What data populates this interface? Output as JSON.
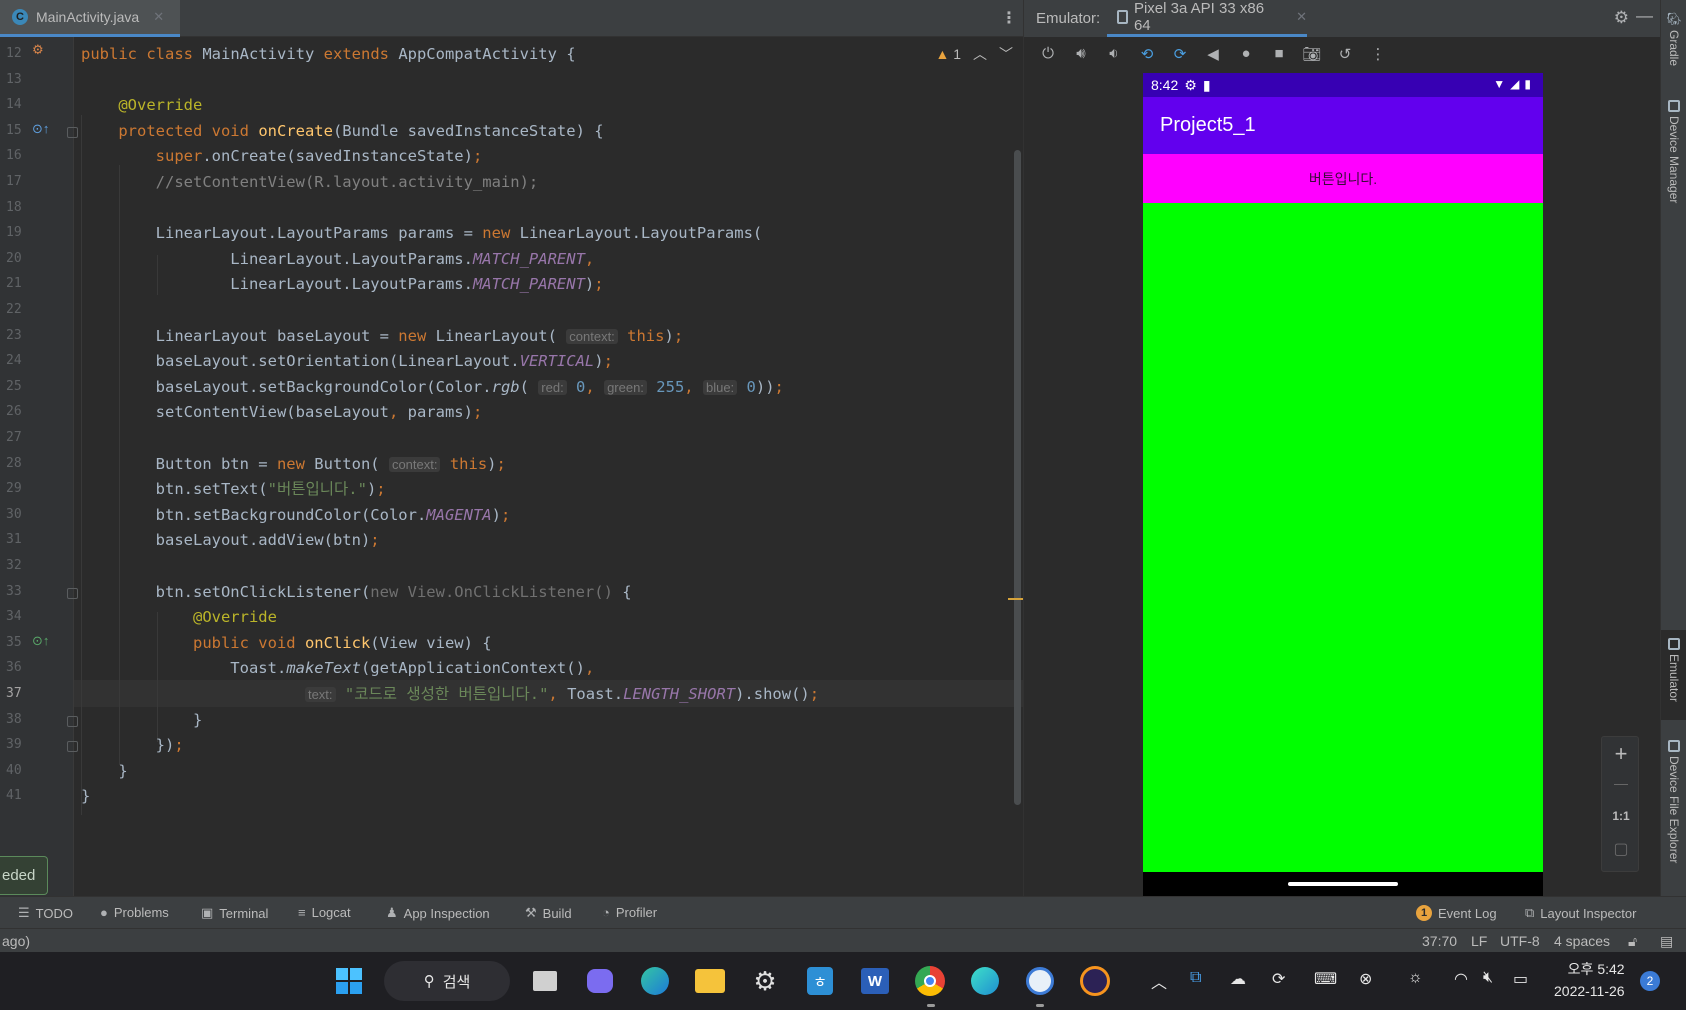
{
  "editor": {
    "tab_label": "MainActivity.java",
    "tab_badge": "C",
    "warning_count": "1",
    "lines": [
      {
        "n": "12",
        "html": "<span class='kw'>public class </span>MainActivity <span class='kw'>extends </span>AppCompatActivity {"
      },
      {
        "n": "13",
        "html": ""
      },
      {
        "n": "14",
        "html": "    <span class='ann'>@Override</span>"
      },
      {
        "n": "15",
        "html": "    <span class='kw'>protected void </span><span class='fn'>onCreate</span>(Bundle savedInstanceState) {"
      },
      {
        "n": "16",
        "html": "        <span class='kw'>super</span>.onCreate(savedInstanceState)<span class='kw'>;</span>"
      },
      {
        "n": "17",
        "html": "        <span class='cm'>//setContentView(R.layout.activity_main);</span>"
      },
      {
        "n": "18",
        "html": ""
      },
      {
        "n": "19",
        "html": "        LinearLayout.LayoutParams params = <span class='kw'>new </span>LinearLayout.LayoutParams("
      },
      {
        "n": "20",
        "html": "                LinearLayout.LayoutParams.<span class='fld'>MATCH_PARENT</span><span class='kw'>,</span>"
      },
      {
        "n": "21",
        "html": "                LinearLayout.LayoutParams.<span class='fld'>MATCH_PARENT</span>)<span class='kw'>;</span>"
      },
      {
        "n": "22",
        "html": ""
      },
      {
        "n": "23",
        "html": "        LinearLayout baseLayout = <span class='kw'>new </span>LinearLayout( <span class='hint'>context:</span> <span class='kw'>this</span>)<span class='kw'>;</span>"
      },
      {
        "n": "24",
        "html": "        baseLayout.setOrientation(LinearLayout.<span class='fld'>VERTICAL</span>)<span class='kw'>;</span>"
      },
      {
        "n": "25",
        "html": "        baseLayout.setBackgroundColor(Color.<span class='ital'>rgb</span>( <span class='hint'>red:</span> <span class='num'>0</span><span class='kw'>,</span> <span class='hint'>green:</span> <span class='num'>255</span><span class='kw'>,</span> <span class='hint'>blue:</span> <span class='num'>0</span>))<span class='kw'>;</span>"
      },
      {
        "n": "26",
        "html": "        setContentView(baseLayout<span class='kw'>, </span>params)<span class='kw'>;</span>"
      },
      {
        "n": "27",
        "html": ""
      },
      {
        "n": "28",
        "html": "        Button btn = <span class='kw'>new </span>Button( <span class='hint'>context:</span> <span class='kw'>this</span>)<span class='kw'>;</span>"
      },
      {
        "n": "29",
        "html": "        btn.setText(<span class='str'>\"버튼입니다.\"</span>)<span class='kw'>;</span>"
      },
      {
        "n": "30",
        "html": "        btn.setBackgroundColor(Color.<span class='fld'>MAGENTA</span>)<span class='kw'>;</span>"
      },
      {
        "n": "31",
        "html": "        baseLayout.addView(btn)<span class='kw'>;</span>"
      },
      {
        "n": "32",
        "html": ""
      },
      {
        "n": "33",
        "html": "        btn.setOnClickListener(<span class='dim'>new View.OnClickListener() </span>{"
      },
      {
        "n": "34",
        "html": "            <span class='ann'>@Override</span>"
      },
      {
        "n": "35",
        "html": "            <span class='kw'>public void </span><span class='fn'>onClick</span>(View view) {"
      },
      {
        "n": "36",
        "html": "                Toast.<span class='ital'>makeText</span>(getApplicationContext()<span class='kw'>,</span>"
      },
      {
        "n": "37",
        "html": "                        <span class='hint'>text:</span> <span class='str'>\"코드로 생성한 버튼입니다.\"</span><span class='kw'>, </span>Toast.<span class='fld'>LENGTH_SHORT</span>).show()<span class='kw'>;</span>"
      },
      {
        "n": "38",
        "html": "            }"
      },
      {
        "n": "39",
        "html": "        })<span class='kw'>;</span>"
      },
      {
        "n": "40",
        "html": "    }"
      },
      {
        "n": "41",
        "html": "}"
      }
    ],
    "current_line": "37",
    "partial_toast": "eded"
  },
  "emulator": {
    "label": "Emulator:",
    "device_tab": "Pixel 3a API 33 x86 64",
    "phone": {
      "time": "8:42",
      "app_title": "Project5_1",
      "button_text": "버튼입니다."
    },
    "zoom": {
      "plus": "+",
      "minus": "—",
      "ratio": "1:1"
    }
  },
  "right_strip": [
    "Gradle",
    "Device Manager",
    "Emulator",
    "Device File Explorer"
  ],
  "tool_windows": {
    "todo": "TODO",
    "problems": "Problems",
    "terminal": "Terminal",
    "logcat": "Logcat",
    "app_inspection": "App Inspection",
    "build": "Build",
    "profiler": "Profiler",
    "event_log": "Event Log",
    "event_log_count": "1",
    "layout_inspector": "Layout Inspector"
  },
  "status": {
    "left": "ago)",
    "position": "37:70",
    "line_sep": "LF",
    "encoding": "UTF-8",
    "indent": "4 spaces"
  },
  "taskbar": {
    "search_label": "검색",
    "time": "오후 5:42",
    "date": "2022-11-26",
    "notifications": "2"
  },
  "colors": {
    "status_bar": "#3700b3",
    "app_bar": "#6200ee",
    "button_bg": "#ff00ff",
    "layout_bg": "#00ff00"
  }
}
